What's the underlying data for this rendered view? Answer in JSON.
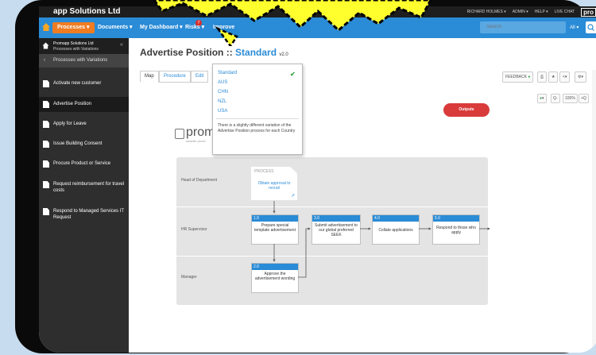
{
  "app_title": "app Solutions Ltd",
  "top_links": [
    "RICHARD HOLMES ▾",
    "ADMIN ▾",
    "HELP ▾",
    "LIVE CHAT"
  ],
  "top_logo": "pro",
  "nav": {
    "processes": "Processes ▾",
    "documents": "Documents ▾",
    "my_dashboard": "My Dashboard ▾",
    "risks": "Risks ▾",
    "improve": "Improve",
    "badge_count": "7",
    "search_placeholder": "Search",
    "search_scope": "All ▾"
  },
  "sidebar": {
    "org": "Promapp Solutions Ltd",
    "group": "Processes with Variations",
    "back_label": "Processes with Variations",
    "items": [
      {
        "label": "Activate new customer"
      },
      {
        "label": "Advertise Position"
      },
      {
        "label": "Apply for Leave"
      },
      {
        "label": "Issue Building Consent"
      },
      {
        "label": "Procure Product or Service"
      },
      {
        "label": "Request reimbursement for travel costs"
      },
      {
        "label": "Respond to Managed Services IT Request"
      }
    ]
  },
  "page": {
    "title_prefix": "Advertise Position :: ",
    "variation": "Standard",
    "version": "v2.0"
  },
  "tabs": [
    "Map",
    "Procedure",
    "Edit"
  ],
  "toolbar": {
    "feedback": "FEEDBACK",
    "zoom_minus": "Q-",
    "zoom_level": "100%",
    "zoom_plus": "+Q"
  },
  "variation_menu": {
    "options": [
      "Standard",
      "AUS",
      "CHN",
      "NZL",
      "USA"
    ],
    "selected": "Standard",
    "description": "There is a slightly different variation of the Advertise Position process for each Country"
  },
  "logo": {
    "text": "prom",
    "sub": "smarter proce"
  },
  "map": {
    "lanes": [
      "Head of Department",
      "HR Supervisor",
      "Manager"
    ],
    "process_node": {
      "label": "PROCESS",
      "title": "Obtain approval to recruit"
    },
    "activities": [
      {
        "num": "1.0",
        "text": "Prepare special template advertisement"
      },
      {
        "num": "2.0",
        "text": "Approve the advertisement wording"
      },
      {
        "num": "3.0",
        "text": "Submit advertisement to our global preferred SEEK"
      },
      {
        "num": "4.0",
        "text": "Collate applications"
      },
      {
        "num": "5.0",
        "text": "Respond to those who apply"
      }
    ],
    "outputs": "Outputs"
  },
  "colors": {
    "accent": "#2a8bd6",
    "orange": "#f07c22",
    "outputs": "#d93a3a",
    "burst": "#ffff2e"
  }
}
